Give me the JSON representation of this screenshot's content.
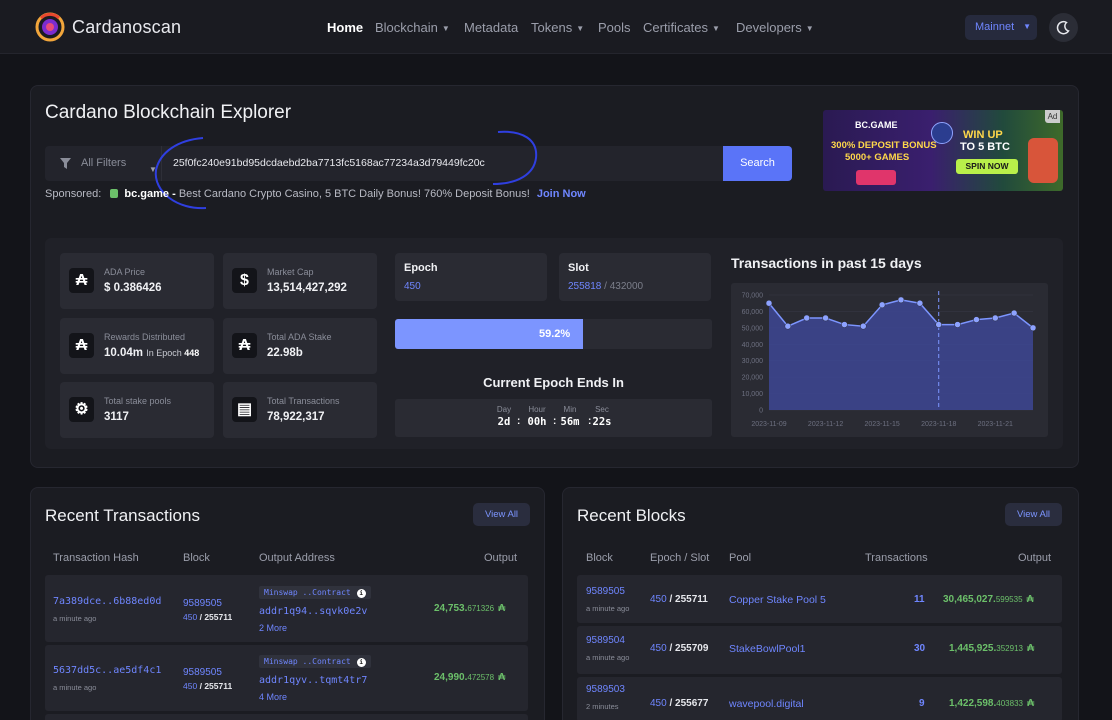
{
  "header": {
    "brand": "Cardanoscan",
    "nav": [
      {
        "label": "Home",
        "dropdown": false
      },
      {
        "label": "Blockchain",
        "dropdown": true
      },
      {
        "label": "Metadata",
        "dropdown": false
      },
      {
        "label": "Tokens",
        "dropdown": true
      },
      {
        "label": "Pools",
        "dropdown": false
      },
      {
        "label": "Certificates",
        "dropdown": true
      },
      {
        "label": "Developers",
        "dropdown": true
      }
    ],
    "network": "Mainnet"
  },
  "hero": {
    "title": "Cardano Blockchain Explorer",
    "filter_label": "All Filters",
    "search_value": "25f0fc240e91bd95dcdaebd2ba7713fc5168ac77234a3d79449fc20c",
    "search_button": "Search",
    "sponsor_label": "Sponsored:",
    "sponsor_name": "bc.game -",
    "sponsor_text": "Best Cardano Crypto Casino, 5 BTC Daily Bonus! 760% Deposit Bonus!",
    "sponsor_link": "Join Now",
    "ad": {
      "badge": "Ad",
      "brand": "BC.GAME",
      "line1": "300% DEPOSIT BONUS",
      "line2": "5000+ GAMES",
      "win1": "WIN UP",
      "win2": "TO 5 BTC",
      "spin": "SPIN NOW"
    }
  },
  "stats": {
    "ada_price": {
      "label": "ADA Price",
      "value": "$ 0.386426"
    },
    "market_cap": {
      "label": "Market Cap",
      "value": "13,514,427,292"
    },
    "rewards": {
      "label": "Rewards Distributed",
      "value": "10.04m",
      "sub_prefix": "In Epoch",
      "sub_epoch": "448"
    },
    "total_stake": {
      "label": "Total ADA Stake",
      "value": "22.98b"
    },
    "stake_pools": {
      "label": "Total stake pools",
      "value": "3117"
    },
    "transactions": {
      "label": "Total Transactions",
      "value": "78,922,317"
    }
  },
  "epoch": {
    "epoch_title": "Epoch",
    "epoch_value": "450",
    "slot_title": "Slot",
    "slot_value": "255818",
    "slot_total": "/ 432000",
    "progress": 0.592,
    "progress_label": "59.2%",
    "ends_title": "Current Epoch Ends In",
    "countdown": [
      {
        "label": "Day",
        "value": "2d"
      },
      {
        "label": "Hour",
        "value": "00h"
      },
      {
        "label": "Min",
        "value": "56m"
      },
      {
        "label": "Sec",
        "value": "22s"
      }
    ]
  },
  "chart_data": {
    "type": "area",
    "title": "Transactions in past 15 days",
    "x": [
      "2023-11-09",
      "2023-11-10",
      "2023-11-11",
      "2023-11-12",
      "2023-11-13",
      "2023-11-14",
      "2023-11-15",
      "2023-11-16",
      "2023-11-17",
      "2023-11-18",
      "2023-11-19",
      "2023-11-20",
      "2023-11-21",
      "2023-11-22",
      "2023-11-23"
    ],
    "x_tick_labels": [
      "2023-11-09",
      "2023-11-12",
      "2023-11-15",
      "2023-11-18",
      "2023-11-21"
    ],
    "values": [
      65000,
      51000,
      56000,
      56000,
      52000,
      51000,
      64000,
      67000,
      65000,
      52000,
      52000,
      55000,
      56000,
      59000,
      50000
    ],
    "ylim": [
      0,
      70000
    ],
    "y_ticks": [
      "0",
      "10,000",
      "20,000",
      "30,000",
      "40,000",
      "50,000",
      "60,000",
      "70,000"
    ],
    "marker_date": "2023-11-18",
    "grid": true,
    "fill_color": "#3d4694",
    "line_color": "#7c95ff"
  },
  "recent_transactions": {
    "title": "Recent Transactions",
    "view_all": "View All",
    "columns": [
      "Transaction Hash",
      "Block",
      "Output Address",
      "Output"
    ],
    "rows": [
      {
        "hash": "7a389dce..6b88ed0d",
        "time": "a minute ago",
        "block": "9589505",
        "epoch": "450",
        "slot": "255711",
        "tag": "Minswap ..Contract",
        "address": "addr1q94..sqvk0e2v",
        "more": "2 More",
        "output_main": "24,753.",
        "output_dec": "671326"
      },
      {
        "hash": "5637dd5c..ae5df4c1",
        "time": "a minute ago",
        "block": "9589505",
        "epoch": "450",
        "slot": "255711",
        "tag": "Minswap ..Contract",
        "address": "addr1qyv..tqmt4tr7",
        "more": "4 More",
        "output_main": "24,990.",
        "output_dec": "472578"
      }
    ]
  },
  "recent_blocks": {
    "title": "Recent Blocks",
    "view_all": "View All",
    "columns": [
      "Block",
      "Epoch / Slot",
      "Pool",
      "Transactions",
      "Output"
    ],
    "rows": [
      {
        "block": "9589505",
        "time": "a minute ago",
        "epoch": "450",
        "slot": "255711",
        "pool": "Copper Stake Pool 5",
        "txs": "11",
        "output_main": "30,465,027.",
        "output_dec": "599535"
      },
      {
        "block": "9589504",
        "time": "a minute ago",
        "epoch": "450",
        "slot": "255709",
        "pool": "StakeBowlPool1",
        "txs": "30",
        "output_main": "1,445,925.",
        "output_dec": "352913"
      },
      {
        "block": "9589503",
        "time": "2 minutes",
        "epoch": "450",
        "slot": "255677",
        "pool": "wavepool.digital",
        "txs": "9",
        "output_main": "1,422,598.",
        "output_dec": "403833"
      }
    ]
  },
  "ada_symbol": "₳"
}
